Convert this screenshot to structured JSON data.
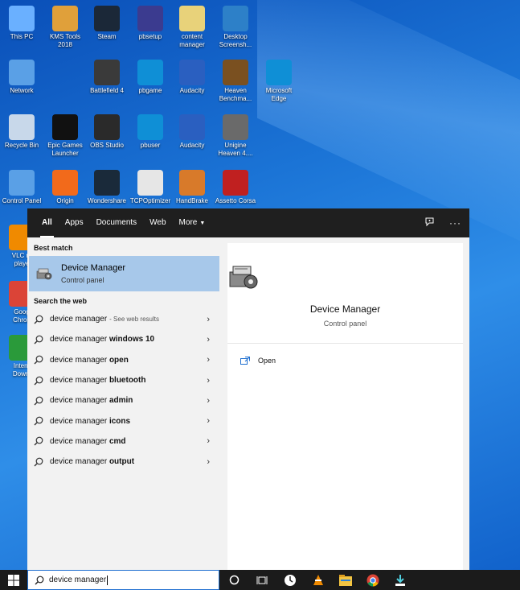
{
  "desktop": {
    "icons": [
      {
        "label1": "This PC",
        "label2": "",
        "color": "#6ab0ff"
      },
      {
        "label1": "KMS Tools",
        "label2": "2018",
        "color": "#e0a03a"
      },
      {
        "label1": "Steam",
        "label2": "",
        "color": "#1b2838"
      },
      {
        "label1": "pbsetup",
        "label2": "",
        "color": "#3b3b8f"
      },
      {
        "label1": "content",
        "label2": "manager",
        "color": "#e8d27a"
      },
      {
        "label1": "Desktop",
        "label2": "Screensh...",
        "color": "#2d80c8"
      },
      {
        "label1": "Network",
        "label2": "",
        "color": "#5aa0e6"
      },
      {
        "label1": "Battlefield 4",
        "label2": "",
        "color": "#3a3a3a"
      },
      {
        "label1": "pbgame",
        "label2": "",
        "color": "#0f8fd6"
      },
      {
        "label1": "Audacity",
        "label2": "",
        "color": "#2a5fc0"
      },
      {
        "label1": "Heaven",
        "label2": "Benchma...",
        "color": "#7a5020"
      },
      {
        "label1": "Microsoft",
        "label2": "Edge",
        "color": "#0f8fd6"
      },
      {
        "label1": "Recycle Bin",
        "label2": "",
        "color": "#c8d8ea"
      },
      {
        "label1": "Epic Games",
        "label2": "Launcher",
        "color": "#111111"
      },
      {
        "label1": "OBS Studio",
        "label2": "",
        "color": "#2a2a2a"
      },
      {
        "label1": "pbuser",
        "label2": "",
        "color": "#0f8fd6"
      },
      {
        "label1": "Audacity",
        "label2": "",
        "color": "#2a5fc0"
      },
      {
        "label1": "Unigine",
        "label2": "Heaven 4....",
        "color": "#6a6a6a"
      },
      {
        "label1": "Control Panel",
        "label2": "",
        "color": "#5aa0e6"
      },
      {
        "label1": "Origin",
        "label2": "",
        "color": "#f26a1b"
      },
      {
        "label1": "Wondershare",
        "label2": "",
        "color": "#1a2a3a"
      },
      {
        "label1": "TCPOptimizer",
        "label2": "",
        "color": "#e6e6e6"
      },
      {
        "label1": "HandBrake",
        "label2": "",
        "color": "#d87a2a"
      },
      {
        "label1": "Assetto Corsa",
        "label2": "",
        "color": "#c02020"
      },
      {
        "label1": "VLC m",
        "label2": "playe",
        "color": "#f08a00"
      },
      {
        "label1": "Goog",
        "label2": "Chron",
        "color": "#db4437"
      },
      {
        "label1": "Intern",
        "label2": "Downl",
        "color": "#2a9a3a"
      }
    ]
  },
  "search_panel": {
    "tabs": [
      "All",
      "Apps",
      "Documents",
      "Web",
      "More"
    ],
    "best_match_title": "Best match",
    "best_match": {
      "name": "Device Manager",
      "type": "Control panel"
    },
    "search_web_title": "Search the web",
    "web_results": [
      {
        "base": "device manager",
        "bold": "",
        "hint": "- See web results"
      },
      {
        "base": "device manager ",
        "bold": "windows 10",
        "hint": ""
      },
      {
        "base": "device manager ",
        "bold": "open",
        "hint": ""
      },
      {
        "base": "device manager ",
        "bold": "bluetooth",
        "hint": ""
      },
      {
        "base": "device manager ",
        "bold": "admin",
        "hint": ""
      },
      {
        "base": "device manager ",
        "bold": "icons",
        "hint": ""
      },
      {
        "base": "device manager ",
        "bold": "cmd",
        "hint": ""
      },
      {
        "base": "device manager ",
        "bold": "output",
        "hint": ""
      }
    ],
    "detail": {
      "name": "Device Manager",
      "type": "Control panel",
      "open_label": "Open"
    }
  },
  "taskbar": {
    "search_value": "device manager",
    "accent": "#1f6fd0"
  }
}
